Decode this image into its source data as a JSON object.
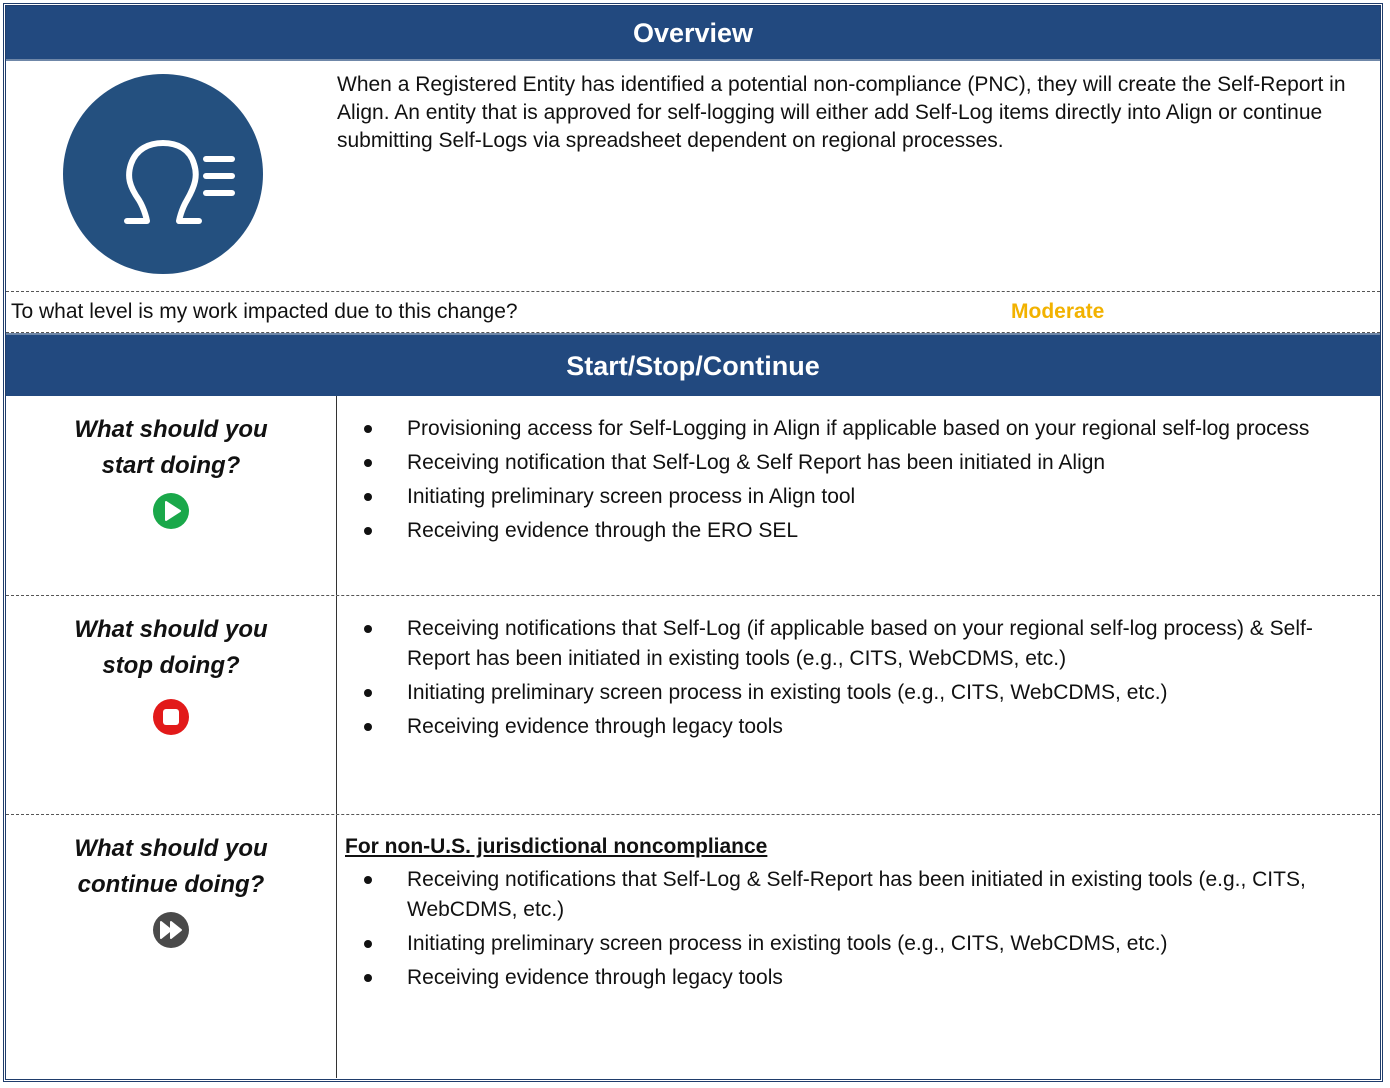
{
  "overview": {
    "title": "Overview",
    "text": "When a Registered Entity has identified a potential non-compliance (PNC), they will create the Self-Report in Align. An entity that is approved for self-logging will either add Self-Log items directly into Align or continue submitting Self-Logs via spreadsheet dependent on regional processes.",
    "icon": "self-report-icon",
    "icon_color": "#24507f"
  },
  "impact": {
    "question": "To what level is my work impacted due to this change?",
    "level": "Moderate",
    "level_color": "#f2b200"
  },
  "ssc": {
    "title": "Start/Stop/Continue",
    "header_color": "#22497f",
    "start": {
      "question": "What should you\nstart doing?",
      "icon": "play-icon",
      "icon_color": "#1aa84a",
      "bullets": [
        "Provisioning access for Self-Logging in Align if applicable based on your regional self-log process",
        "Receiving notification that Self-Log & Self Report has been initiated in Align",
        "Initiating preliminary screen process in Align tool",
        "Receiving evidence through the ERO SEL"
      ]
    },
    "stop": {
      "question": "What should you\nstop doing?",
      "icon": "stop-icon",
      "icon_color": "#e21a1a",
      "bullets": [
        "Receiving notifications that Self-Log (if applicable based on your regional self-log process) & Self-Report has been initiated in existing tools (e.g., CITS, WebCDMS, etc.)",
        "Initiating preliminary screen process in existing tools (e.g., CITS, WebCDMS, etc.)",
        "Receiving evidence through legacy tools"
      ]
    },
    "continue": {
      "question": "What should you\ncontinue doing?",
      "icon": "fast-forward-icon",
      "icon_color": "#4a4a4a",
      "subheading": "For non-U.S. jurisdictional noncompliance",
      "bullets": [
        " Receiving notifications that Self-Log & Self-Report has been initiated in existing tools (e.g., CITS, WebCDMS, etc.)",
        "Initiating preliminary screen process in existing tools (e.g., CITS, WebCDMS, etc.)",
        "Receiving evidence through legacy tools"
      ]
    }
  }
}
